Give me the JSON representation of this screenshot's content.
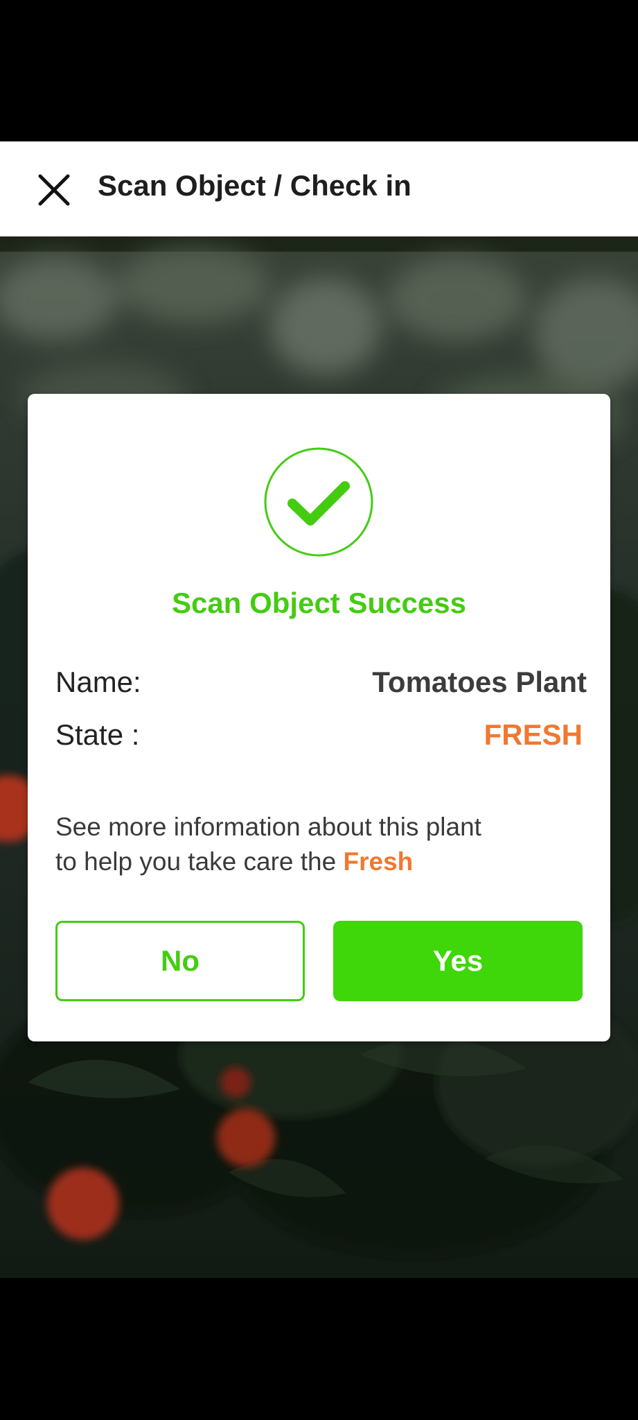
{
  "app_bar": {
    "title": "Scan Object / Check in",
    "close_icon": "close-icon"
  },
  "dialog": {
    "icon": "check-circle-icon",
    "title": "Scan Object Success",
    "name_label": "Name:",
    "name_value": "Tomatoes Plant",
    "state_label": "State :",
    "state_value": "FRESH",
    "info_line1": "See more information about this plant",
    "info_line2_prefix": "to help you take care the ",
    "info_line2_highlight": "Fresh",
    "no_label": "No",
    "yes_label": "Yes"
  },
  "colors": {
    "accent_green": "#44cc11",
    "button_green": "#3fd60a",
    "state_orange": "#f07830",
    "app_bar_bg": "#ffffff",
    "text_dark": "#1e1e1e"
  }
}
